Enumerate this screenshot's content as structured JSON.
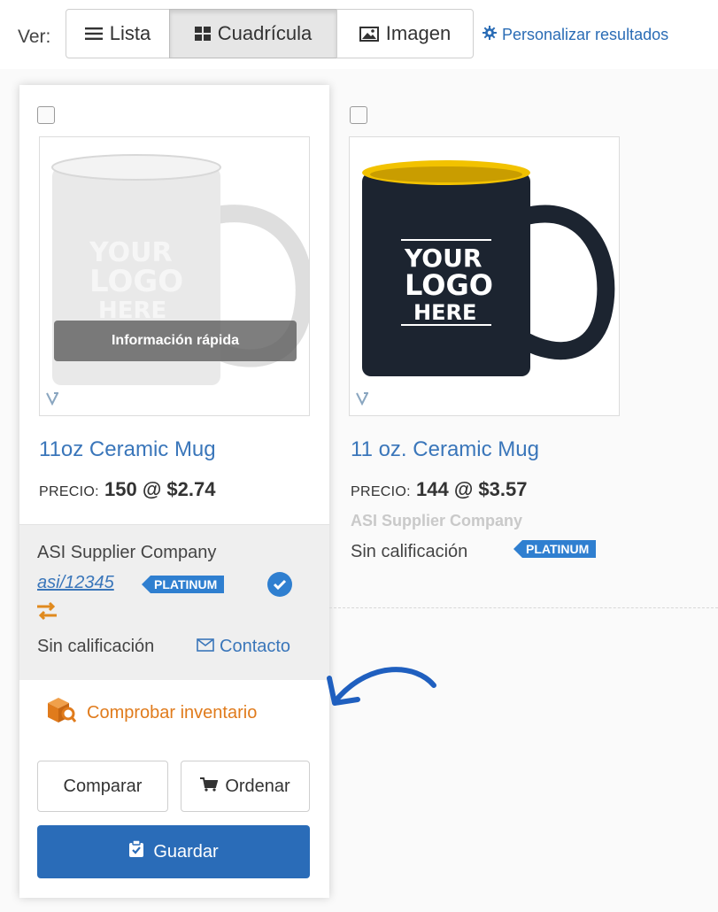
{
  "toolbar": {
    "ver_label": "Ver:",
    "lista_label": "Lista",
    "grid_label": "Cuadrícula",
    "image_label": "Imagen",
    "customize_label": "Personalizar resultados",
    "active_view": "Cuadrícula"
  },
  "products": [
    {
      "name": "11oz Ceramic Mug",
      "price_label": "PRECIO:",
      "price_value": "150 @ $2.74",
      "quick_info_label": "Información rápida",
      "mug_logo": [
        "YOUR",
        "LOGO",
        "HERE"
      ],
      "mug_color": "#e9e9e9",
      "supplier": {
        "name": "ASI Supplier Company",
        "asi_number": "asi/12345",
        "badge": "PLATINUM",
        "rating": "Sin calificación",
        "contact_label": "Contacto"
      },
      "inventory_label": "Comprobar inventario",
      "compare_label": "Comparar",
      "order_label": "Ordenar",
      "save_label": "Guardar"
    },
    {
      "name": "11 oz. Ceramic Mug",
      "price_label": "PRECIO:",
      "price_value": "144 @ $3.57",
      "mug_logo": [
        "YOUR",
        "LOGO",
        "HERE"
      ],
      "mug_color": "#1c2430",
      "mug_inner_color": "#f2c200",
      "supplier": {
        "name": "ASI Supplier Company",
        "badge": "PLATINUM",
        "rating": "Sin calificación"
      }
    }
  ],
  "colors": {
    "link_blue": "#3a76ba",
    "badge_blue": "#2f7fd0",
    "save_button": "#2a6cb8",
    "inventory_orange": "#e07b1c"
  }
}
